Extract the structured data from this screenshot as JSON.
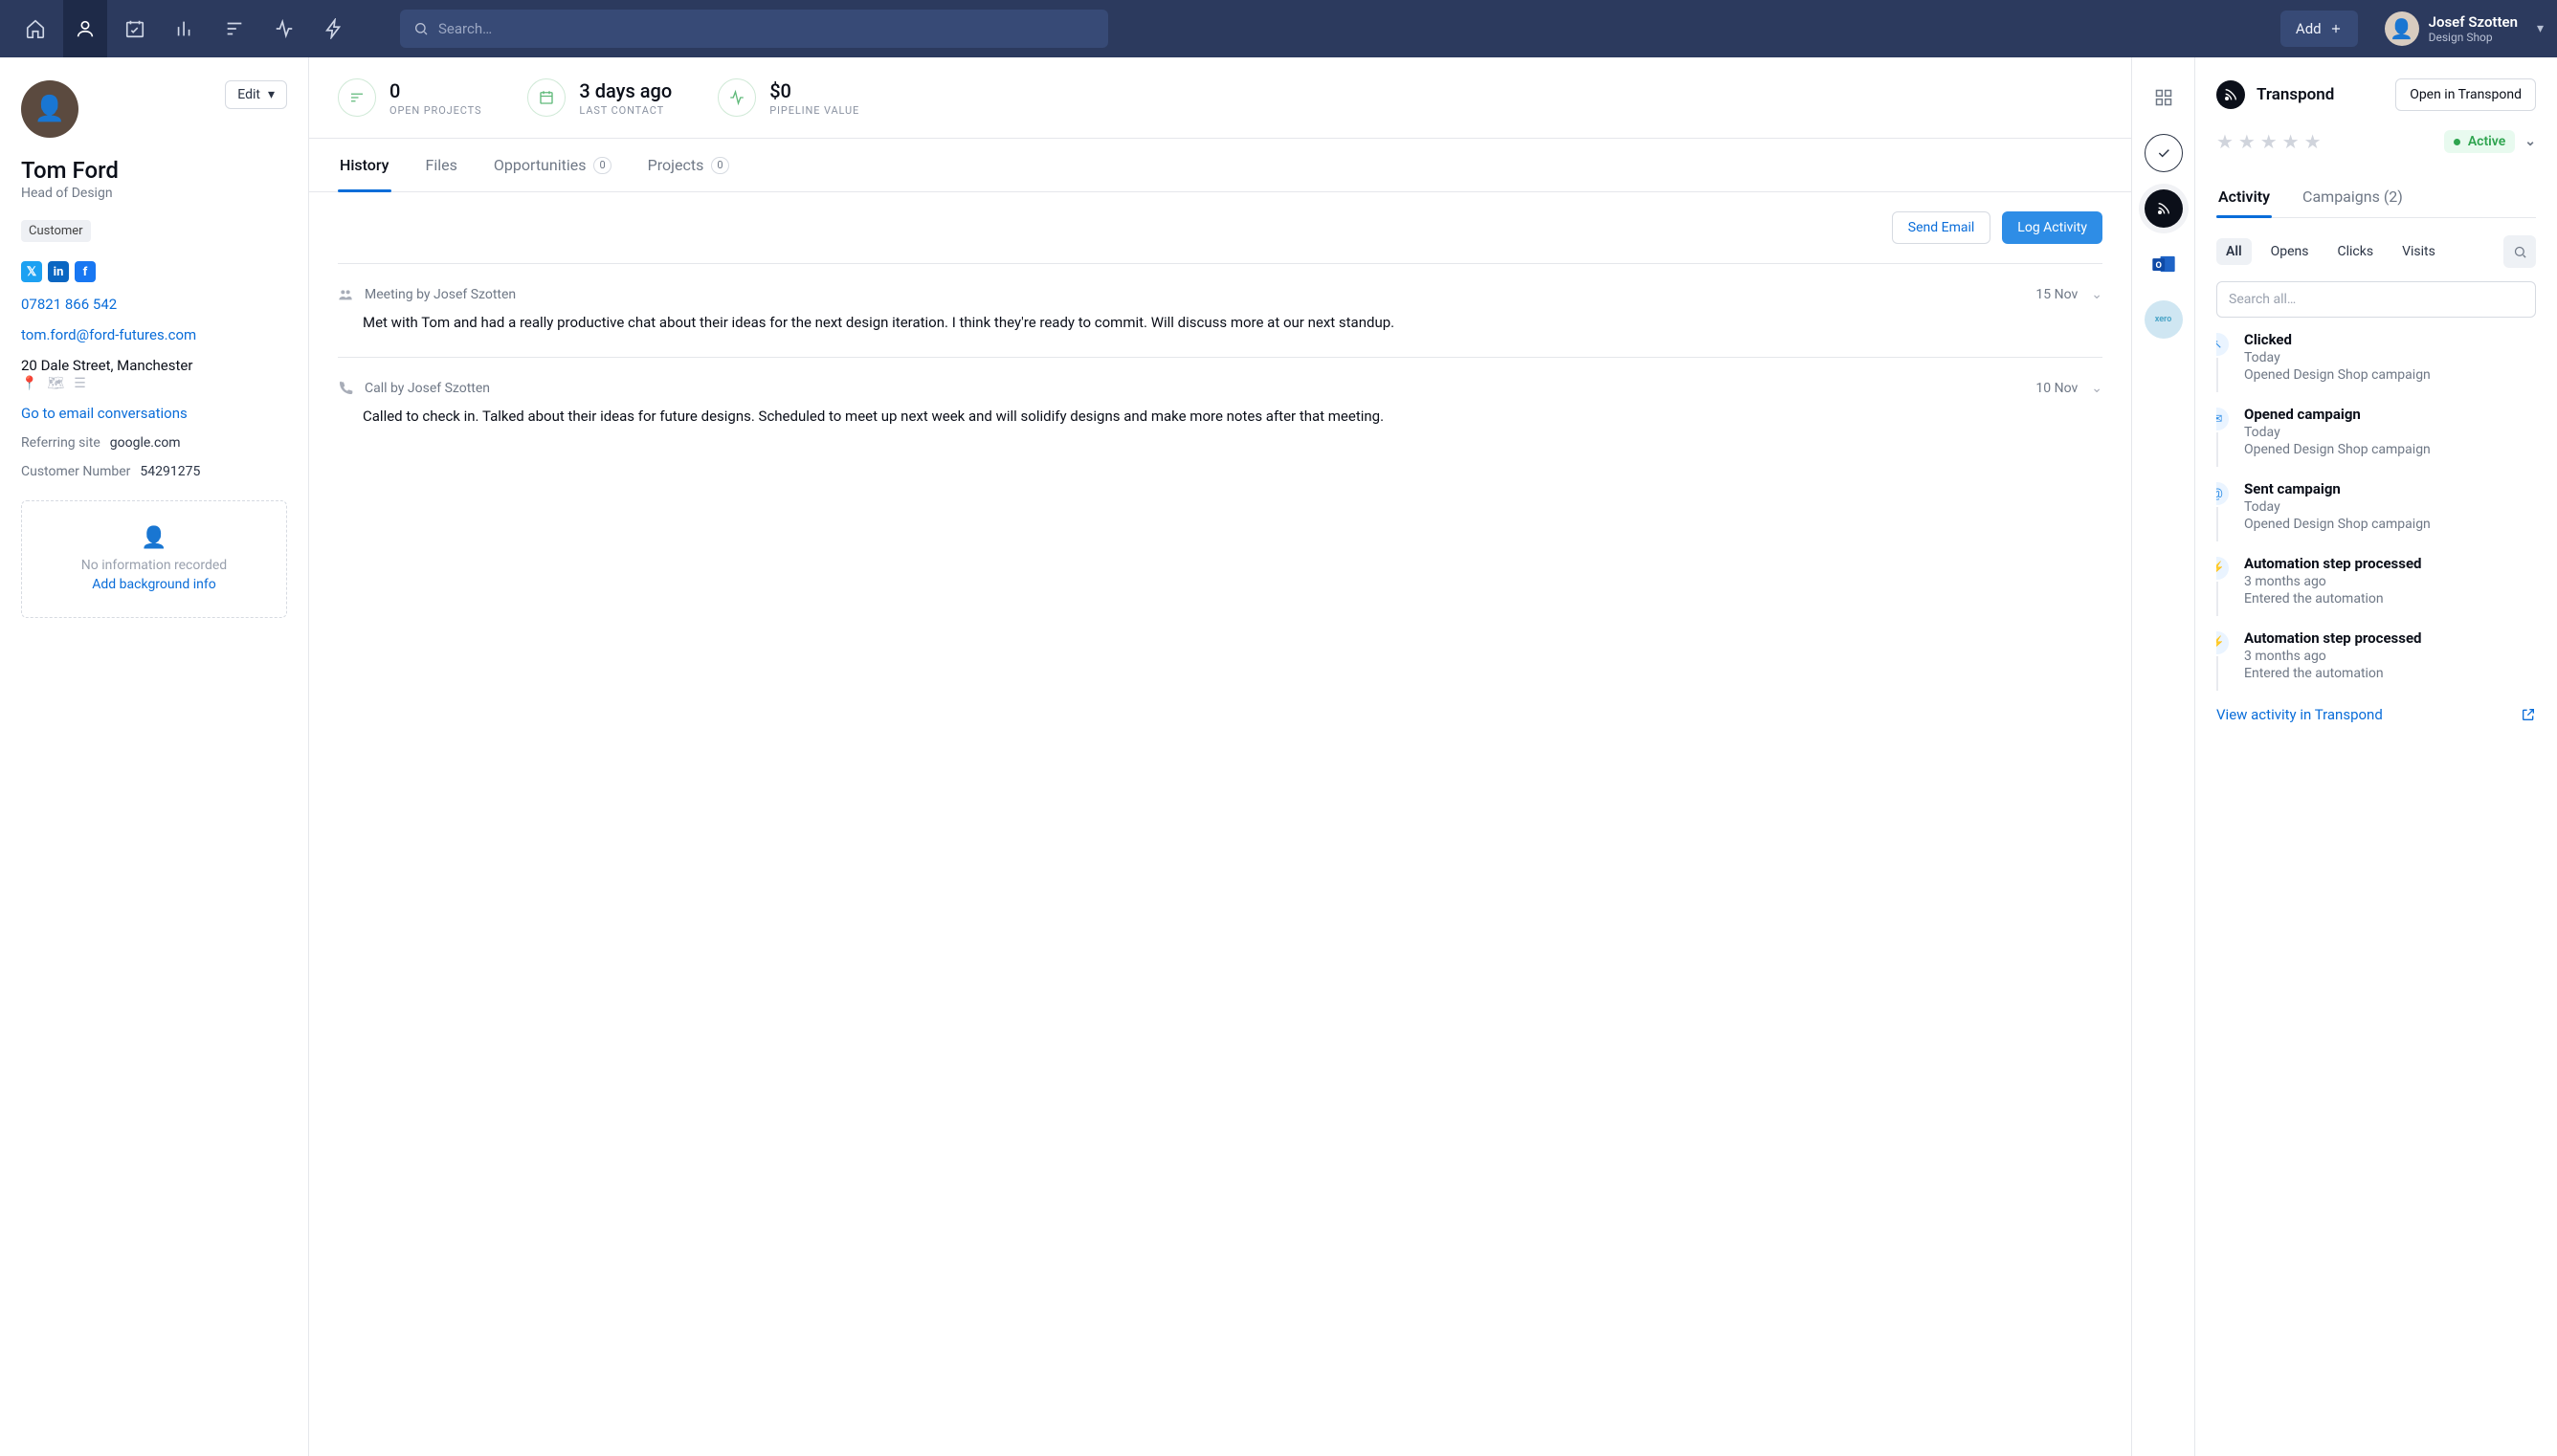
{
  "topbar": {
    "search_placeholder": "Search…",
    "add_label": "Add",
    "user_name": "Josef Szotten",
    "user_org": "Design Shop"
  },
  "contact": {
    "name": "Tom Ford",
    "title": "Head of Design",
    "tag": "Customer",
    "phone": "07821 866 542",
    "email": "tom.ford@ford-futures.com",
    "address": "20 Dale Street, Manchester",
    "convo_link": "Go to email conversations",
    "referring_label": "Referring site",
    "referring_value": "google.com",
    "custnum_label": "Customer Number",
    "custnum_value": "54291275",
    "edit_label": "Edit",
    "no_info_text": "No information recorded",
    "add_bg_text": "Add background info"
  },
  "stats": {
    "projects_value": "0",
    "projects_label": "Open Projects",
    "last_contact_value": "3 days ago",
    "last_contact_label": "Last Contact",
    "pipeline_value": "$0",
    "pipeline_label": "Pipeline Value"
  },
  "tabs": {
    "history": "History",
    "files": "Files",
    "opps": "Opportunities",
    "opps_count": "0",
    "projects": "Projects",
    "projects_count": "0"
  },
  "actions": {
    "send_email": "Send Email",
    "log_activity": "Log Activity"
  },
  "timeline": {
    "e0": {
      "kind": "Meeting by Josef Szotten",
      "date": "15 Nov",
      "body": "Met with Tom and had a really productive chat about their ideas for the next design iteration. I think they're ready to commit. Will discuss more at our next standup."
    },
    "e1": {
      "kind": "Call by Josef Szotten",
      "date": "10 Nov",
      "body": "Called to check in. Talked about their ideas for future designs. Scheduled to meet up next week and will solidify designs and make more notes after that meeting."
    }
  },
  "right": {
    "brand": "Transpond",
    "open_btn": "Open in Transpond",
    "status": "Active",
    "tab_activity": "Activity",
    "tab_campaigns": "Campaigns (2)",
    "filter_all": "All",
    "filter_opens": "Opens",
    "filter_clicks": "Clicks",
    "filter_visits": "Visits",
    "search_placeholder": "Search all…",
    "feed": {
      "i0": {
        "title": "Clicked",
        "sub": "Today",
        "desc": "Opened Design Shop campaign"
      },
      "i1": {
        "title": "Opened campaign",
        "sub": "Today",
        "desc": "Opened Design Shop campaign"
      },
      "i2": {
        "title": "Sent campaign",
        "sub": "Today",
        "desc": "Opened Design Shop campaign"
      },
      "i3": {
        "title": "Automation step processed",
        "sub": "3 months ago",
        "desc": "Entered the automation"
      },
      "i4": {
        "title": "Automation step processed",
        "sub": "3 months ago",
        "desc": "Entered the automation"
      }
    },
    "view_link": "View activity in Transpond"
  }
}
